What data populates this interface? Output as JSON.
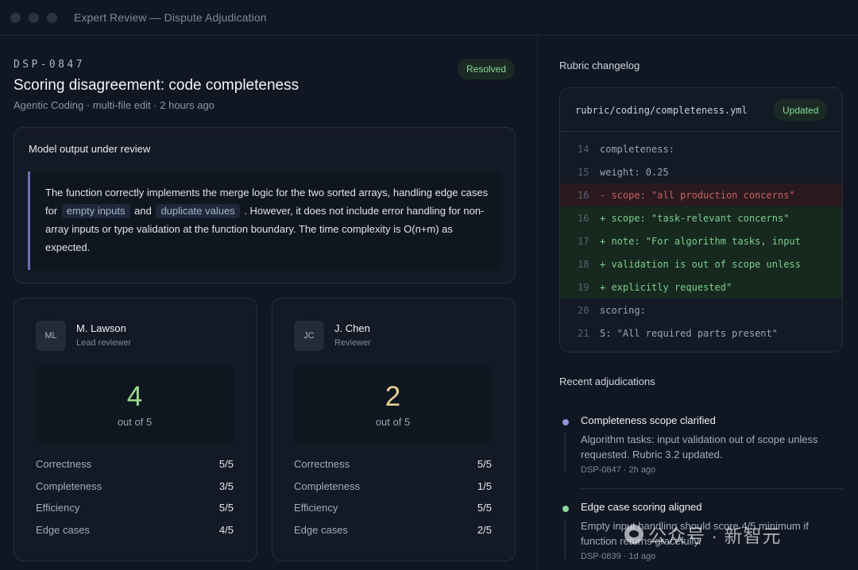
{
  "window": {
    "title": "Expert Review — Dispute Adjudication"
  },
  "dispute": {
    "id": "DSP-0847",
    "status": "Resolved",
    "title": "Scoring disagreement: code completeness",
    "subtitle": "Agentic Coding · multi-file edit · 2 hours ago"
  },
  "model_output": {
    "heading": "Model output under review",
    "text_1": "The function correctly implements the merge logic for the two sorted arrays, handling edge cases for",
    "chip_1": "empty inputs",
    "text_2": "and",
    "chip_2": "duplicate values",
    "text_3": ". However, it does not include error handling for non-array inputs or type validation at the function boundary. The time complexity is O(n+m) as expected."
  },
  "reviewers": [
    {
      "initials": "ML",
      "name": "M. Lawson",
      "role": "Lead reviewer",
      "score": "4",
      "score_out": "out of 5",
      "score_color": "#9bd88f",
      "criteria": [
        {
          "label": "Correctness",
          "value": "5/5"
        },
        {
          "label": "Completeness",
          "value": "3/5"
        },
        {
          "label": "Efficiency",
          "value": "5/5"
        },
        {
          "label": "Edge cases",
          "value": "4/5"
        }
      ]
    },
    {
      "initials": "JC",
      "name": "J. Chen",
      "role": "Reviewer",
      "score": "2",
      "score_out": "out of 5",
      "score_color": "#e7cf93",
      "criteria": [
        {
          "label": "Correctness",
          "value": "5/5"
        },
        {
          "label": "Completeness",
          "value": "1/5"
        },
        {
          "label": "Efficiency",
          "value": "5/5"
        },
        {
          "label": "Edge cases",
          "value": "2/5"
        }
      ]
    }
  ],
  "changelog": {
    "heading": "Rubric changelog",
    "file": "rubric/coding/completeness.yml",
    "badge": "Updated",
    "lines": [
      {
        "num": "14",
        "type": "ctx",
        "code": "completeness:"
      },
      {
        "num": "15",
        "type": "ctx",
        "code": "weight: 0.25"
      },
      {
        "num": "16",
        "type": "del",
        "code": "- scope: \"all production concerns\""
      },
      {
        "num": "16",
        "type": "add",
        "code": "+ scope: \"task-relevant concerns\""
      },
      {
        "num": "17",
        "type": "add",
        "code": "+ note: \"For algorithm tasks, input"
      },
      {
        "num": "18",
        "type": "add",
        "code": "+ validation is out of scope unless"
      },
      {
        "num": "19",
        "type": "add",
        "code": "+ explicitly requested\""
      },
      {
        "num": "20",
        "type": "ctx",
        "code": "scoring:"
      },
      {
        "num": "21",
        "type": "ctx",
        "code": "5: \"All required parts present\""
      }
    ]
  },
  "adjudications": {
    "heading": "Recent adjudications",
    "items": [
      {
        "title": "Completeness scope clarified",
        "desc": "Algorithm tasks: input validation out of scope unless requested. Rubric 3.2 updated.",
        "meta": "DSP-0847 · 2h ago",
        "color": "#8f93e0"
      },
      {
        "title": "Edge case scoring aligned",
        "desc": "Empty input handling should score 4/5 minimum if function returns gracefully.",
        "meta": "DSP-0839 · 1d ago",
        "color": "#86d99a"
      }
    ]
  },
  "watermark": {
    "text": "公众号 · 新智元"
  }
}
